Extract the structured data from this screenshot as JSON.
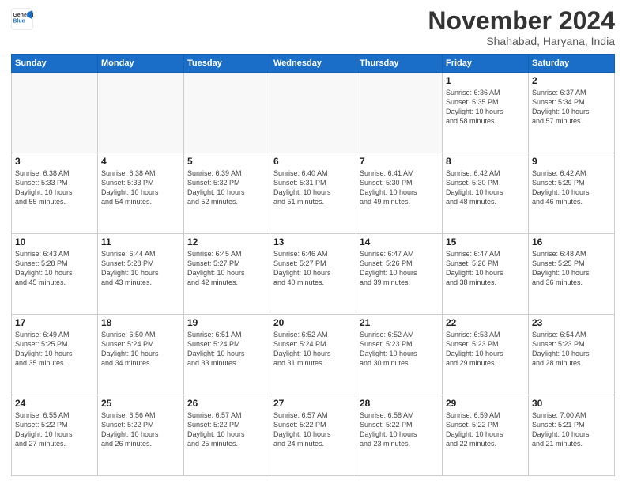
{
  "header": {
    "logo_line1": "General",
    "logo_line2": "Blue",
    "month": "November 2024",
    "location": "Shahabad, Haryana, India"
  },
  "weekdays": [
    "Sunday",
    "Monday",
    "Tuesday",
    "Wednesday",
    "Thursday",
    "Friday",
    "Saturday"
  ],
  "weeks": [
    [
      {
        "day": "",
        "info": ""
      },
      {
        "day": "",
        "info": ""
      },
      {
        "day": "",
        "info": ""
      },
      {
        "day": "",
        "info": ""
      },
      {
        "day": "",
        "info": ""
      },
      {
        "day": "1",
        "info": "Sunrise: 6:36 AM\nSunset: 5:35 PM\nDaylight: 10 hours\nand 58 minutes."
      },
      {
        "day": "2",
        "info": "Sunrise: 6:37 AM\nSunset: 5:34 PM\nDaylight: 10 hours\nand 57 minutes."
      }
    ],
    [
      {
        "day": "3",
        "info": "Sunrise: 6:38 AM\nSunset: 5:33 PM\nDaylight: 10 hours\nand 55 minutes."
      },
      {
        "day": "4",
        "info": "Sunrise: 6:38 AM\nSunset: 5:33 PM\nDaylight: 10 hours\nand 54 minutes."
      },
      {
        "day": "5",
        "info": "Sunrise: 6:39 AM\nSunset: 5:32 PM\nDaylight: 10 hours\nand 52 minutes."
      },
      {
        "day": "6",
        "info": "Sunrise: 6:40 AM\nSunset: 5:31 PM\nDaylight: 10 hours\nand 51 minutes."
      },
      {
        "day": "7",
        "info": "Sunrise: 6:41 AM\nSunset: 5:30 PM\nDaylight: 10 hours\nand 49 minutes."
      },
      {
        "day": "8",
        "info": "Sunrise: 6:42 AM\nSunset: 5:30 PM\nDaylight: 10 hours\nand 48 minutes."
      },
      {
        "day": "9",
        "info": "Sunrise: 6:42 AM\nSunset: 5:29 PM\nDaylight: 10 hours\nand 46 minutes."
      }
    ],
    [
      {
        "day": "10",
        "info": "Sunrise: 6:43 AM\nSunset: 5:28 PM\nDaylight: 10 hours\nand 45 minutes."
      },
      {
        "day": "11",
        "info": "Sunrise: 6:44 AM\nSunset: 5:28 PM\nDaylight: 10 hours\nand 43 minutes."
      },
      {
        "day": "12",
        "info": "Sunrise: 6:45 AM\nSunset: 5:27 PM\nDaylight: 10 hours\nand 42 minutes."
      },
      {
        "day": "13",
        "info": "Sunrise: 6:46 AM\nSunset: 5:27 PM\nDaylight: 10 hours\nand 40 minutes."
      },
      {
        "day": "14",
        "info": "Sunrise: 6:47 AM\nSunset: 5:26 PM\nDaylight: 10 hours\nand 39 minutes."
      },
      {
        "day": "15",
        "info": "Sunrise: 6:47 AM\nSunset: 5:26 PM\nDaylight: 10 hours\nand 38 minutes."
      },
      {
        "day": "16",
        "info": "Sunrise: 6:48 AM\nSunset: 5:25 PM\nDaylight: 10 hours\nand 36 minutes."
      }
    ],
    [
      {
        "day": "17",
        "info": "Sunrise: 6:49 AM\nSunset: 5:25 PM\nDaylight: 10 hours\nand 35 minutes."
      },
      {
        "day": "18",
        "info": "Sunrise: 6:50 AM\nSunset: 5:24 PM\nDaylight: 10 hours\nand 34 minutes."
      },
      {
        "day": "19",
        "info": "Sunrise: 6:51 AM\nSunset: 5:24 PM\nDaylight: 10 hours\nand 33 minutes."
      },
      {
        "day": "20",
        "info": "Sunrise: 6:52 AM\nSunset: 5:24 PM\nDaylight: 10 hours\nand 31 minutes."
      },
      {
        "day": "21",
        "info": "Sunrise: 6:52 AM\nSunset: 5:23 PM\nDaylight: 10 hours\nand 30 minutes."
      },
      {
        "day": "22",
        "info": "Sunrise: 6:53 AM\nSunset: 5:23 PM\nDaylight: 10 hours\nand 29 minutes."
      },
      {
        "day": "23",
        "info": "Sunrise: 6:54 AM\nSunset: 5:23 PM\nDaylight: 10 hours\nand 28 minutes."
      }
    ],
    [
      {
        "day": "24",
        "info": "Sunrise: 6:55 AM\nSunset: 5:22 PM\nDaylight: 10 hours\nand 27 minutes."
      },
      {
        "day": "25",
        "info": "Sunrise: 6:56 AM\nSunset: 5:22 PM\nDaylight: 10 hours\nand 26 minutes."
      },
      {
        "day": "26",
        "info": "Sunrise: 6:57 AM\nSunset: 5:22 PM\nDaylight: 10 hours\nand 25 minutes."
      },
      {
        "day": "27",
        "info": "Sunrise: 6:57 AM\nSunset: 5:22 PM\nDaylight: 10 hours\nand 24 minutes."
      },
      {
        "day": "28",
        "info": "Sunrise: 6:58 AM\nSunset: 5:22 PM\nDaylight: 10 hours\nand 23 minutes."
      },
      {
        "day": "29",
        "info": "Sunrise: 6:59 AM\nSunset: 5:22 PM\nDaylight: 10 hours\nand 22 minutes."
      },
      {
        "day": "30",
        "info": "Sunrise: 7:00 AM\nSunset: 5:21 PM\nDaylight: 10 hours\nand 21 minutes."
      }
    ]
  ]
}
